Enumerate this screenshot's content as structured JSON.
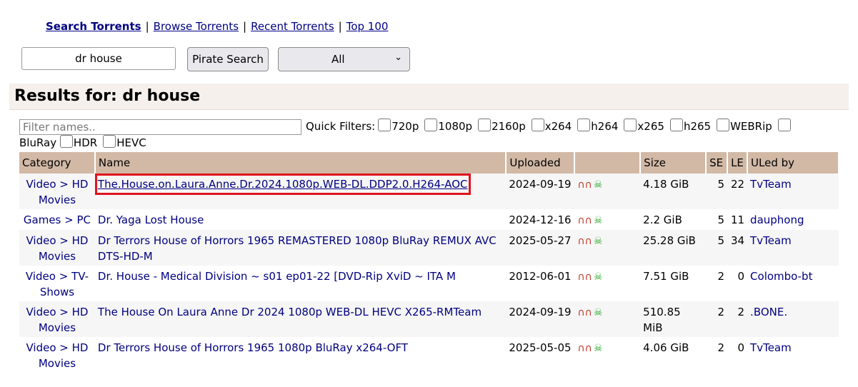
{
  "nav": {
    "search": "Search Torrents",
    "browse": "Browse Torrents",
    "recent": "Recent Torrents",
    "top100": "Top 100",
    "sep": "|"
  },
  "search": {
    "query": "dr house",
    "button": "Pirate Search",
    "category": "All"
  },
  "results_title": "Results for: dr house",
  "filters": {
    "placeholder": "Filter names..",
    "quick_label": "Quick Filters:",
    "options": [
      "720p",
      "1080p",
      "2160p",
      "x264",
      "h264",
      "x265",
      "h265",
      "WEBRip",
      "BluRay",
      "HDR",
      "HEVC"
    ]
  },
  "table": {
    "headers": [
      "Category",
      "Name",
      "Uploaded",
      "",
      "Size",
      "SE",
      "LE",
      "ULed by"
    ],
    "rows": [
      {
        "cat1": "Video > HD",
        "cat2": "Movies",
        "name": "The.House.on.Laura.Anne.Dr.2024.1080p.WEB-DL.DDP2.0.H264-AOC",
        "uploaded": "2024-09-19",
        "size": "4.18 GiB",
        "se": "5",
        "le": "22",
        "uled": "TvTeam"
      },
      {
        "cat1": "Games > PC",
        "cat2": "",
        "name": "Dr. Yaga Lost House",
        "uploaded": "2024-12-16",
        "size": "2.2 GiB",
        "se": "5",
        "le": "11",
        "uled": "dauphong"
      },
      {
        "cat1": "Video > HD",
        "cat2": "Movies",
        "name": "Dr Terrors House of Horrors 1965 REMASTERED 1080p BluRay REMUX AVC DTS-HD-M",
        "uploaded": "2025-05-27",
        "size": "25.28 GiB",
        "se": "5",
        "le": "34",
        "uled": "TvTeam"
      },
      {
        "cat1": "Video > TV-",
        "cat2": "Shows",
        "name": "Dr. House - Medical Division ~ s01 ep01-22 [DVD-Rip XviD ~ ITA M",
        "uploaded": "2012-06-01",
        "size": "7.51 GiB",
        "se": "2",
        "le": "0",
        "uled": "Colombo-bt"
      },
      {
        "cat1": "Video > HD",
        "cat2": "Movies",
        "name": "The House On Laura Anne Dr 2024 1080p WEB-DL HEVC X265-RMTeam",
        "uploaded": "2024-09-19",
        "size": "510.85 MiB",
        "se": "2",
        "le": "2",
        "uled": ".BONE."
      },
      {
        "cat1": "Video > HD",
        "cat2": "Movies",
        "name": "Dr Terrors House of Horrors 1965 1080p BluRay x264-OFT",
        "uploaded": "2025-05-05",
        "size": "4.06 GiB",
        "se": "2",
        "le": "0",
        "uled": "TvTeam"
      }
    ]
  },
  "icons": {
    "magnet": "magnet-icon",
    "trusted": "skull-icon"
  },
  "colors": {
    "link": "#000080",
    "header_bg": "#d2b9a6",
    "highlight": "#e0141e"
  }
}
